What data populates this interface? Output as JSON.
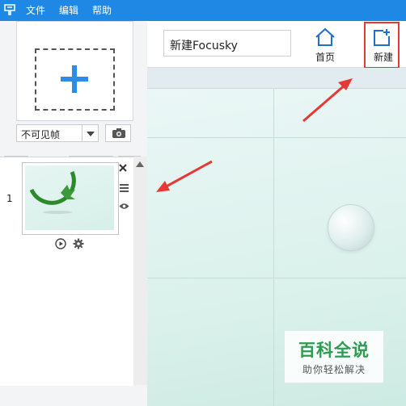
{
  "menubar": {
    "logo_icon": "app-logo-icon",
    "items": [
      {
        "label": "文件"
      },
      {
        "label": "编辑"
      },
      {
        "label": "帮助"
      }
    ],
    "background": "#1f88e5"
  },
  "left_panel": {
    "add_frame": {
      "icon": "plus-icon",
      "accent": "#2d8ce8"
    },
    "visibility_select": {
      "value": "不可见帧"
    },
    "camera_icon": "camera-icon",
    "toolbar_icons": [
      "align-left-icon",
      "zoom-icon",
      "align-right-icon",
      "swap-icon"
    ],
    "slides": [
      {
        "number": "1"
      }
    ]
  },
  "header": {
    "title_value": "新建Focusky",
    "home_label": "首页",
    "new_label": "新建"
  },
  "watermark": {
    "main": "百科全说",
    "sub": "助你轻松解决"
  }
}
